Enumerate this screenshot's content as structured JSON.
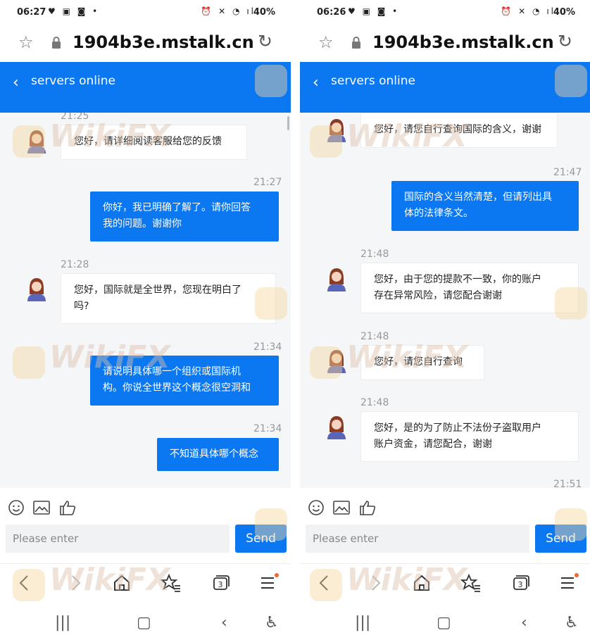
{
  "left": {
    "status": {
      "time": "06:27",
      "battery": "40%"
    },
    "url": "1904b3e.mstalk.cn",
    "header_title": "servers online",
    "messages": [
      {
        "time": "21:25",
        "side": "in",
        "text": "您好，请详细阅读客服给您的反馈"
      },
      {
        "time": "21:27",
        "side": "out",
        "lines": [
          "你好，我已明确了解了。请你回答",
          "我的问题。谢谢你"
        ]
      },
      {
        "time": "21:28",
        "side": "in",
        "lines": [
          "您好，国际就是全世界，您现在明白了",
          "吗?"
        ]
      },
      {
        "time": "21:34",
        "side": "out",
        "lines": [
          "请说明具体哪一个组织或国际机",
          "构。你说全世界这个概念很空洞和"
        ]
      },
      {
        "time": "21:34",
        "side": "out",
        "text": "不知道具体哪个概念"
      }
    ],
    "input_placeholder": "Please enter",
    "send_label": "Send"
  },
  "right": {
    "status": {
      "time": "06:26",
      "battery": "40%"
    },
    "url": "1904b3e.mstalk.cn",
    "header_title": "servers online",
    "messages": [
      {
        "side": "in",
        "text": "您好，请您自行查询国际的含义，谢谢"
      },
      {
        "time": "21:47",
        "side": "out",
        "lines": [
          "国际的含义当然清楚，但请列出具",
          "体的法律条文。"
        ]
      },
      {
        "time": "21:48",
        "side": "in",
        "lines": [
          "您好，由于您的提款不一致，你的账户",
          "存在异常风险，请您配合谢谢"
        ]
      },
      {
        "time": "21:48",
        "side": "in",
        "text": "您好，请您自行查询"
      },
      {
        "time": "21:48",
        "side": "in",
        "lines": [
          "您好，是的为了防止不法份子盗取用户",
          "账户资金，请您配合，谢谢"
        ]
      },
      {
        "time": "21:51"
      }
    ],
    "input_placeholder": "Please enter",
    "send_label": "Send"
  },
  "watermark": "WikiFX",
  "browser_nav_tabs_count": "3",
  "icons": [
    "star-icon",
    "lock-icon",
    "reload-icon",
    "back-icon",
    "emoji-icon",
    "image-icon",
    "thumbs-up-icon",
    "browser-back-icon",
    "browser-forward-icon",
    "home-icon",
    "bookmarks-icon",
    "tabs-icon",
    "menu-icon",
    "recents-icon",
    "system-home-icon",
    "system-back-icon",
    "accessibility-icon"
  ],
  "colors": {
    "accent": "#0b77f0",
    "chat_bg": "#f5f6f8",
    "menu_dot": "#f06a2c"
  }
}
